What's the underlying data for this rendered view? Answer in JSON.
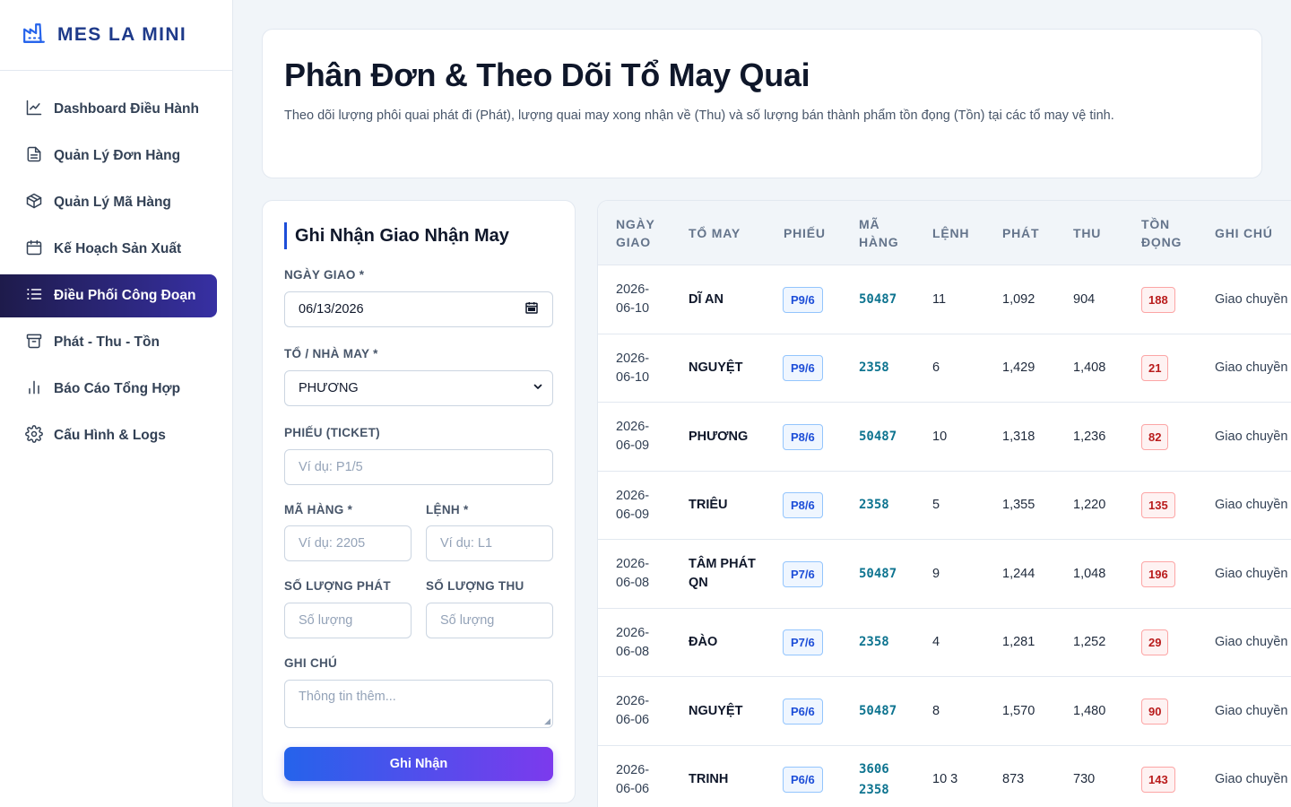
{
  "brand": {
    "name": "MES LA MINI"
  },
  "nav": [
    {
      "label": "Dashboard Điều Hành",
      "icon": "chart-line-icon",
      "active": false
    },
    {
      "label": "Quản Lý Đơn Hàng",
      "icon": "document-icon",
      "active": false
    },
    {
      "label": "Quản Lý Mã Hàng",
      "icon": "box-icon",
      "active": false
    },
    {
      "label": "Kế Hoạch Sản Xuất",
      "icon": "calendar-icon",
      "active": false
    },
    {
      "label": "Điều Phối Công Đoạn",
      "icon": "list-icon",
      "active": true
    },
    {
      "label": "Phát - Thu - Tồn",
      "icon": "archive-icon",
      "active": false
    },
    {
      "label": "Báo Cáo Tổng Hợp",
      "icon": "bar-chart-icon",
      "active": false
    },
    {
      "label": "Cấu Hình & Logs",
      "icon": "gear-icon",
      "active": false
    }
  ],
  "header": {
    "title": "Phân Đơn & Theo Dõi Tổ May Quai",
    "description": "Theo dõi lượng phôi quai phát đi (Phát), lượng quai may xong nhận về (Thu) và số lượng bán thành phẩm tồn đọng (Tồn) tại các tổ may vệ tinh."
  },
  "form": {
    "title": "Ghi Nhận Giao Nhận May",
    "date_label": "NGÀY GIAO *",
    "date_value": "06/13/2026",
    "team_label": "TỔ / NHÀ MAY *",
    "team_value": "PHƯƠNG",
    "ticket_label": "PHIẾU (TICKET)",
    "ticket_placeholder": "Ví dụ: P1/5",
    "code_label": "MÃ HÀNG *",
    "code_placeholder": "Ví dụ: 2205",
    "order_label": "LỆNH *",
    "order_placeholder": "Ví dụ: L1",
    "issue_label": "SỐ LƯỢNG PHÁT",
    "issue_placeholder": "Số lượng",
    "receive_label": "SỐ LƯỢNG THU",
    "receive_placeholder": "Số lượng",
    "note_label": "GHI CHÚ",
    "note_placeholder": "Thông tin thêm...",
    "submit_label": "Ghi Nhận"
  },
  "table": {
    "columns": [
      "NGÀY GIAO",
      "TỔ MAY",
      "PHIẾU",
      "MÃ HÀNG",
      "LỆNH",
      "PHÁT",
      "THU",
      "TỒN ĐỌNG",
      "GHI CHÚ"
    ],
    "rows": [
      {
        "date": "2026-06-10",
        "team": "DĨ AN",
        "ticket": "P9/6",
        "code": "50487",
        "order": "11",
        "issued": "1,092",
        "received": "904",
        "backlog": "188",
        "note": "Giao chuyền"
      },
      {
        "date": "2026-06-10",
        "team": "NGUYỆT",
        "ticket": "P9/6",
        "code": "2358",
        "order": "6",
        "issued": "1,429",
        "received": "1,408",
        "backlog": "21",
        "note": "Giao chuyền"
      },
      {
        "date": "2026-06-09",
        "team": "PHƯƠNG",
        "ticket": "P8/6",
        "code": "50487",
        "order": "10",
        "issued": "1,318",
        "received": "1,236",
        "backlog": "82",
        "note": "Giao chuyền"
      },
      {
        "date": "2026-06-09",
        "team": "TRIÊU",
        "ticket": "P8/6",
        "code": "2358",
        "order": "5",
        "issued": "1,355",
        "received": "1,220",
        "backlog": "135",
        "note": "Giao chuyền"
      },
      {
        "date": "2026-06-08",
        "team": "TÂM PHÁT QN",
        "ticket": "P7/6",
        "code": "50487",
        "order": "9",
        "issued": "1,244",
        "received": "1,048",
        "backlog": "196",
        "note": "Giao chuyền"
      },
      {
        "date": "2026-06-08",
        "team": "ĐÀO",
        "ticket": "P7/6",
        "code": "2358",
        "order": "4",
        "issued": "1,281",
        "received": "1,252",
        "backlog": "29",
        "note": "Giao chuyền"
      },
      {
        "date": "2026-06-06",
        "team": "NGUYỆT",
        "ticket": "P6/6",
        "code": "50487",
        "order": "8",
        "issued": "1,570",
        "received": "1,480",
        "backlog": "90",
        "note": "Giao chuyền"
      },
      {
        "date": "2026-06-06",
        "team": "TRINH",
        "ticket": "P6/6",
        "code": "3606 2358",
        "order": "10 3",
        "issued": "873",
        "received": "730",
        "backlog": "143",
        "note": "Giao chuyền"
      }
    ]
  }
}
